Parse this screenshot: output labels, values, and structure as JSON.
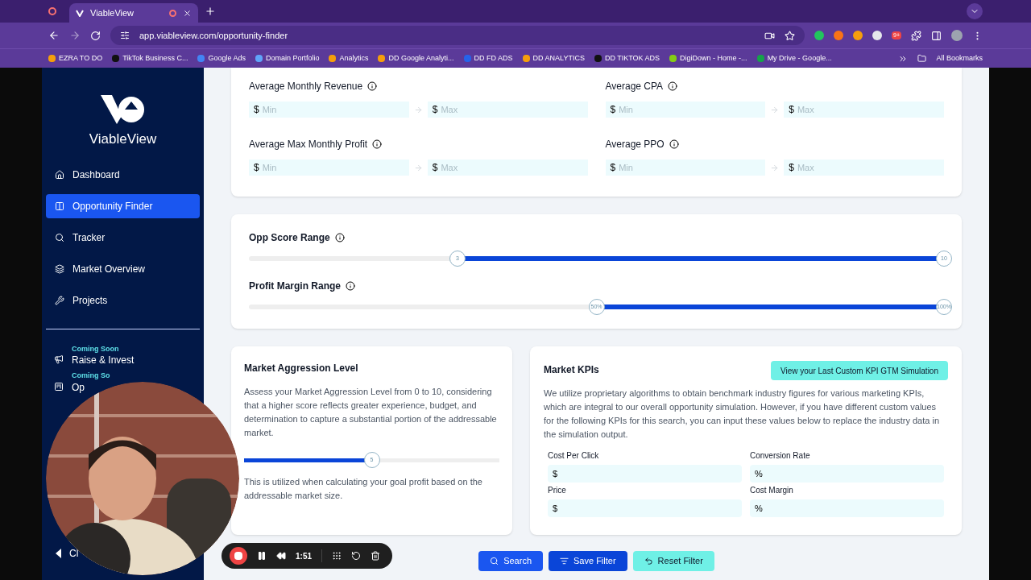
{
  "browser": {
    "tabs": [
      {
        "title": "ViableView",
        "selected": true
      }
    ],
    "url": "app.viableview.com/opportunity-finder",
    "bookmarks": [
      {
        "label": "EZRA TO DO",
        "color": "#f59e0b"
      },
      {
        "label": "TikTok Business C...",
        "color": "#111111"
      },
      {
        "label": "Google Ads",
        "color": "#4285f4"
      },
      {
        "label": "Domain Portfolio",
        "color": "#60a5fa"
      },
      {
        "label": "Analytics",
        "color": "#f59e0b"
      },
      {
        "label": "DD Google Analyti...",
        "color": "#f59e0b"
      },
      {
        "label": "DD FD ADS",
        "color": "#2563eb"
      },
      {
        "label": "DD ANALYTICS",
        "color": "#f59e0b"
      },
      {
        "label": "DD TIKTOK ADS",
        "color": "#111111"
      },
      {
        "label": "DigiDown - Home -...",
        "color": "#84cc16"
      },
      {
        "label": "My Drive - Google...",
        "color": "#16a34a"
      }
    ],
    "all_bookmarks": "All Bookmarks",
    "extension_badge": "9+"
  },
  "sidebar": {
    "brand": "ViableView",
    "items": [
      {
        "label": "Dashboard",
        "selected": false
      },
      {
        "label": "Opportunity Finder",
        "selected": true
      },
      {
        "label": "Tracker",
        "selected": false
      },
      {
        "label": "Market Overview",
        "selected": false
      },
      {
        "label": "Projects",
        "selected": false
      }
    ],
    "coming_soon": [
      {
        "badge": "Coming Soon",
        "label": "Raise & Invest"
      },
      {
        "badge": "Coming So",
        "label": "Op"
      }
    ],
    "collapse_label": "Cl"
  },
  "filters": [
    {
      "label": "Average Monthly Revenue",
      "unit": "$",
      "min_placeholder": "Min",
      "max_placeholder": "Max"
    },
    {
      "label": "Average CPA",
      "unit": "$",
      "min_placeholder": "Min",
      "max_placeholder": "Max"
    },
    {
      "label": "Average Max Monthly Profit",
      "unit": "$",
      "min_placeholder": "Min",
      "max_placeholder": "Max"
    },
    {
      "label": "Average PPO",
      "unit": "$",
      "min_placeholder": "Min",
      "max_placeholder": "Max"
    }
  ],
  "ranges": [
    {
      "label": "Opp Score Range",
      "thumbs": [
        {
          "label": "3",
          "level": 0.3
        },
        {
          "label": "10",
          "level": 1
        }
      ]
    },
    {
      "label": "Profit Margin Range",
      "thumbs": [
        {
          "label": "50%",
          "level": 0.5
        },
        {
          "label": "100%",
          "level": 1
        }
      ]
    }
  ],
  "aggression": {
    "title": "Market Aggression Level",
    "description": "Assess your Market Aggression Level from 0 to 10, considering that a higher score reflects greater experience, budget, and determination to capture a substantial portion of the addressable market.",
    "slider": {
      "label": "5",
      "level": 0.5
    },
    "note": "This is utilized when calculating your goal profit based on the addressable market size."
  },
  "kpis": {
    "title": "Market KPIs",
    "button": "View your Last Custom KPI GTM Simulation",
    "description": "We utilize proprietary algorithms to obtain benchmark industry figures for various marketing KPIs, which are integral to our overall opportunity simulation. However, if you have different custom values for the following KPIs for this search, you can input these values below to replace the industry data in the simulation output.",
    "fields": [
      {
        "label": "Cost Per Click",
        "unit": "$"
      },
      {
        "label": "Conversion Rate",
        "unit": "%"
      },
      {
        "label": "Price",
        "unit": "$"
      },
      {
        "label": "Cost Margin",
        "unit": "%"
      }
    ]
  },
  "actions": [
    {
      "kind": "search",
      "label": "Search"
    },
    {
      "kind": "save",
      "label": "Save Filter"
    },
    {
      "kind": "reset",
      "label": "Reset Filter"
    }
  ],
  "recorder": {
    "time": "1:51"
  }
}
